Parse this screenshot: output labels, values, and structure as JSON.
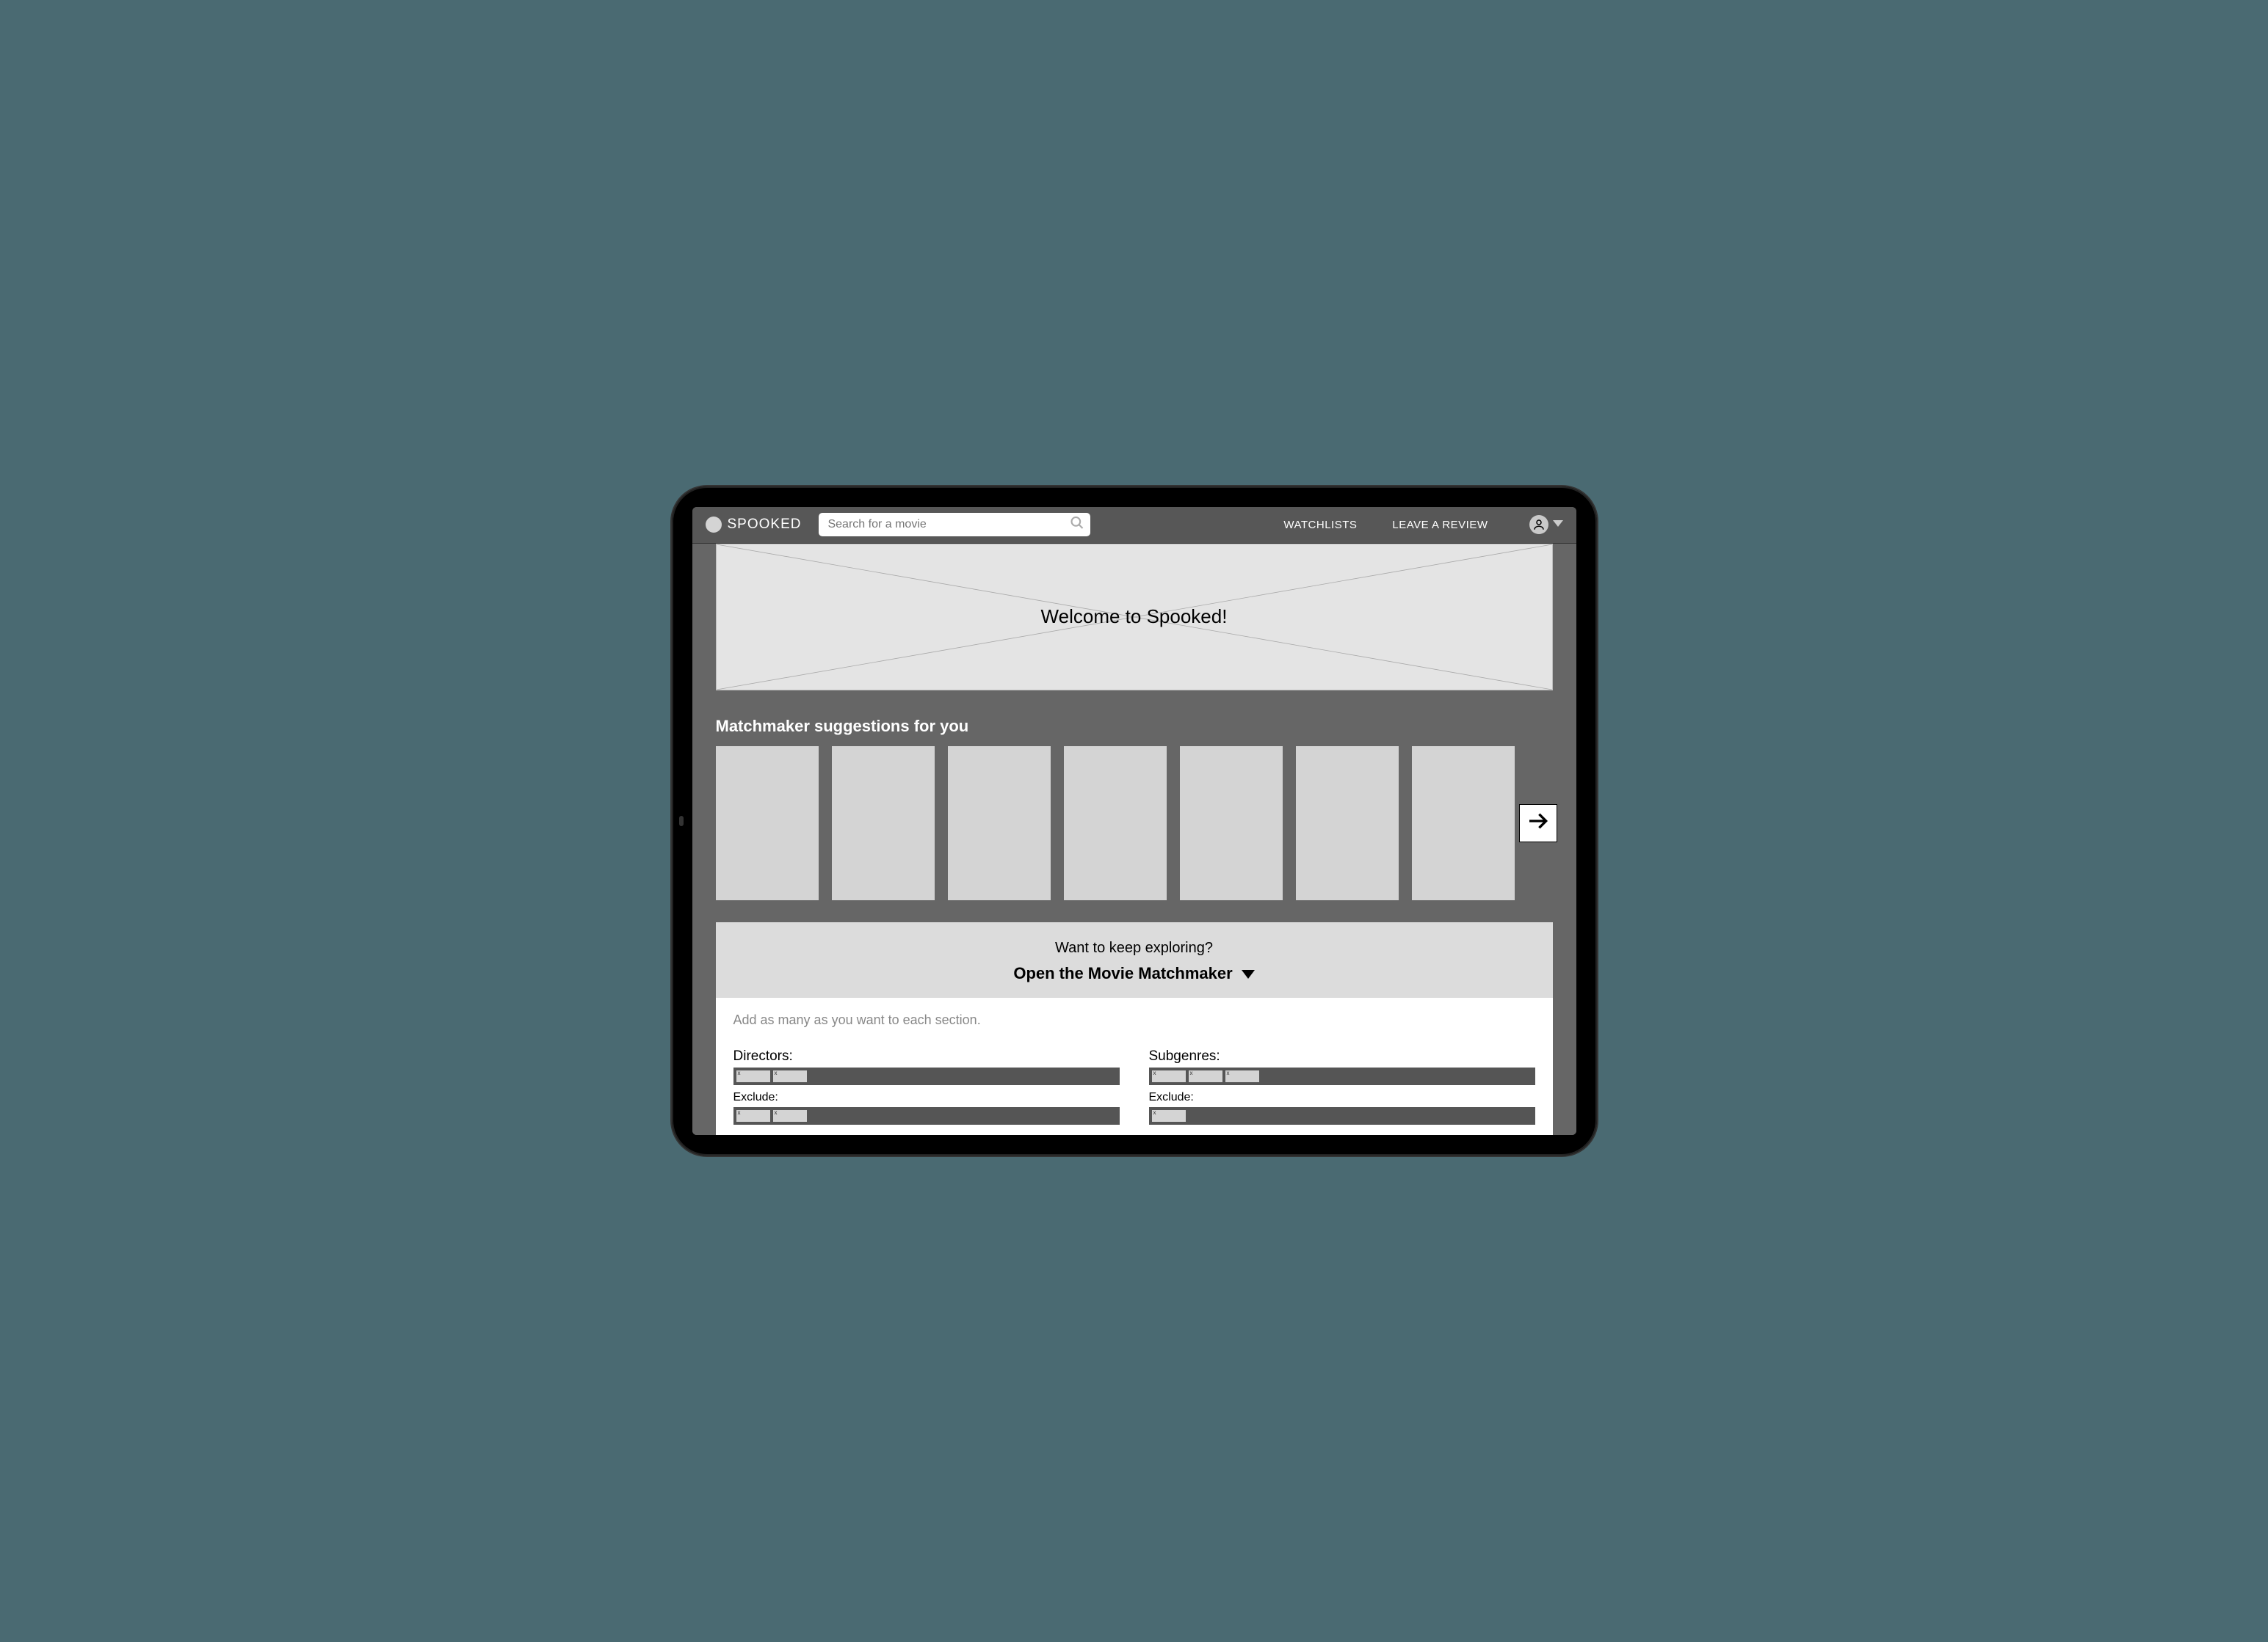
{
  "header": {
    "brand": "SPOOKED",
    "search_placeholder": "Search for a movie",
    "nav": {
      "watchlists": "WATCHLISTS",
      "review": "LEAVE A REVIEW"
    }
  },
  "hero": {
    "title": "Welcome to Spooked!"
  },
  "suggestions": {
    "heading": "Matchmaker suggestions for you",
    "card_count": 7
  },
  "explore": {
    "sub": "Want to keep exploring?",
    "main": "Open the Movie Matchmaker"
  },
  "matchmaker": {
    "hint": "Add as many as you want to each section.",
    "columns": [
      {
        "label": "Directors:",
        "include_tag_count": 2,
        "exclude_label": "Exclude:",
        "exclude_tag_count": 2
      },
      {
        "label": "Subgenres:",
        "include_tag_count": 3,
        "exclude_label": "Exclude:",
        "exclude_tag_count": 1
      }
    ]
  }
}
